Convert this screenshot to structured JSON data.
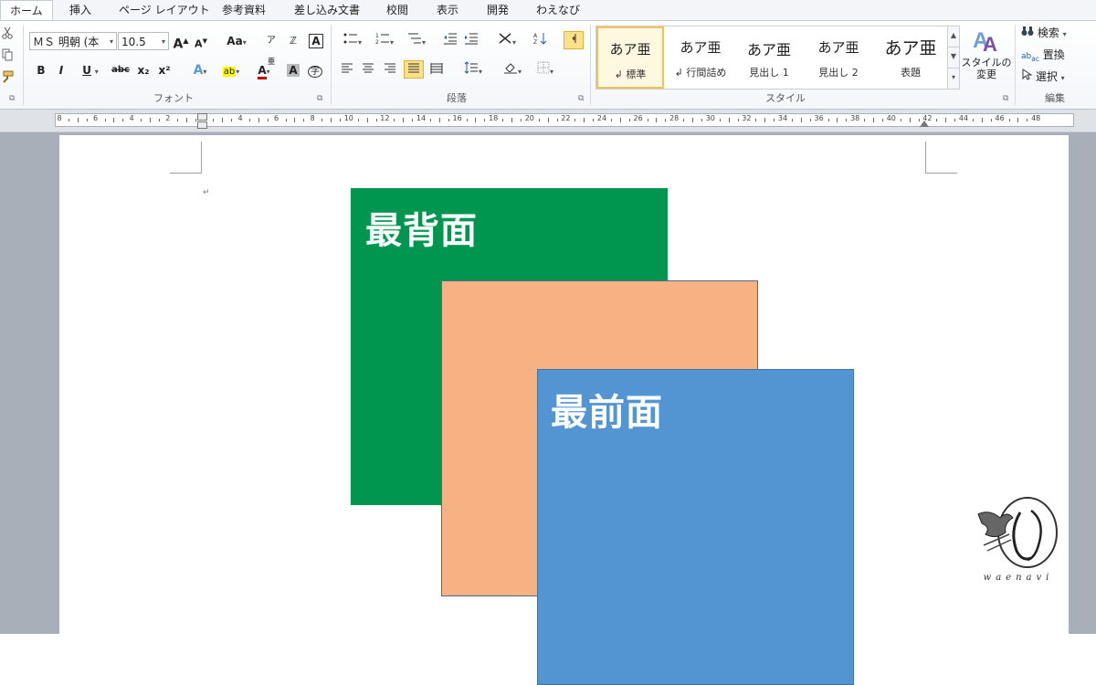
{
  "tabs": [
    "ホーム",
    "挿入",
    "ページ レイアウト",
    "参考資料",
    "差し込み文書",
    "校閲",
    "表示",
    "開発",
    "わえなび"
  ],
  "font_group": {
    "font_name": "ＭＳ 明朝 (本",
    "font_size": "10.5",
    "grow_font": "A",
    "shrink_font": "A",
    "change_case": "Aa",
    "bold": "B",
    "italic": "I",
    "underline": "U",
    "strikethrough": "abc",
    "subscript": "x₂",
    "superscript": "x²",
    "label": "フォント"
  },
  "paragraph_group": {
    "label": "段落"
  },
  "styles_group": {
    "items": [
      {
        "sample": "あア亜",
        "name": "↲ 標準"
      },
      {
        "sample": "あア亜",
        "name": "↲ 行間詰め"
      },
      {
        "sample": "あア亜",
        "name": "見出し 1"
      },
      {
        "sample": "あア亜",
        "name": "見出し 2"
      },
      {
        "sample": "あア亜",
        "name": "表題"
      }
    ],
    "change_styles": "スタイルの変更",
    "label": "スタイル"
  },
  "editing_group": {
    "find": "検索",
    "replace": "置換",
    "select": "選択",
    "label": "編集"
  },
  "ruler": {
    "numbers": [
      "8",
      "6",
      "4",
      "2",
      "2",
      "4",
      "6",
      "8",
      "10",
      "12",
      "14",
      "16",
      "18",
      "20",
      "22",
      "24",
      "26",
      "28",
      "30",
      "32",
      "34",
      "36",
      "38",
      "40",
      "42",
      "44",
      "46",
      "48"
    ]
  },
  "shapes": {
    "back": {
      "text": "最背面",
      "color": "#00964f"
    },
    "middle": {
      "text": "",
      "color": "#f7b183"
    },
    "front": {
      "text": "最前面",
      "color": "#5394d2"
    }
  },
  "logo": {
    "text": "waenavi"
  },
  "colors": {
    "ribbon_bg": "#f4f6f9",
    "accent_highlight": "#fde08a",
    "doc_bg": "#a9afb8"
  }
}
